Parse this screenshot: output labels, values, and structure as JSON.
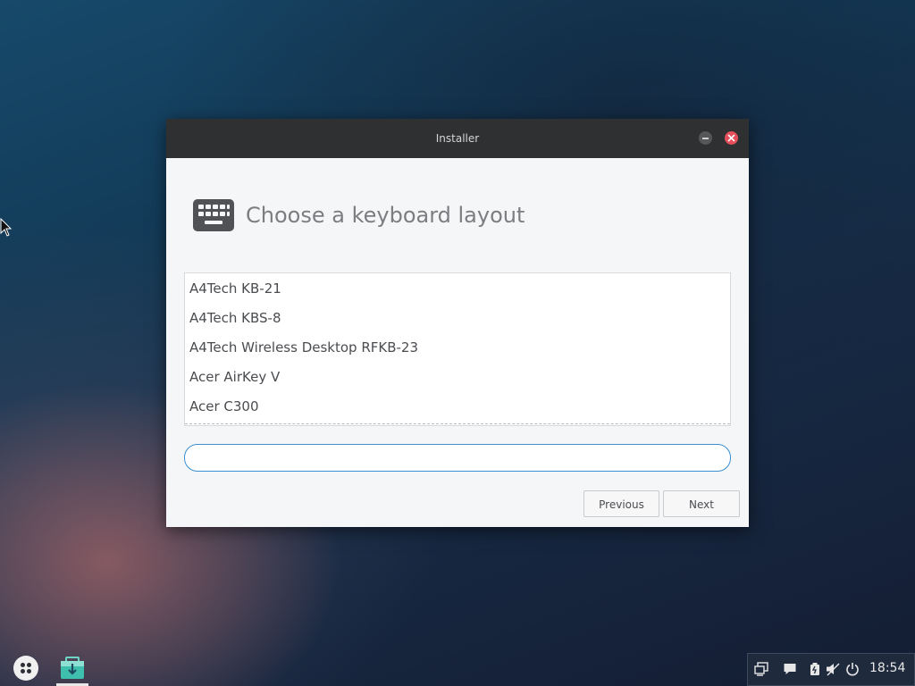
{
  "window": {
    "title": "Installer",
    "heading": "Choose a keyboard layout"
  },
  "layouts": [
    "A4Tech KB-21",
    "A4Tech KBS-8",
    "A4Tech Wireless Desktop RFKB-23",
    "Acer AirKey V",
    "Acer C300"
  ],
  "search": {
    "value": "",
    "placeholder": ""
  },
  "buttons": {
    "previous": "Previous",
    "next": "Next"
  },
  "taskbar": {
    "clock": "18:54",
    "tray_icons": [
      "network-icon",
      "chat-icon",
      "battery-icon",
      "volume-muted-icon",
      "power-icon"
    ]
  },
  "colors": {
    "accent": "#3a8fd0",
    "close": "#e54e5b",
    "titlebar": "#2f3032"
  }
}
